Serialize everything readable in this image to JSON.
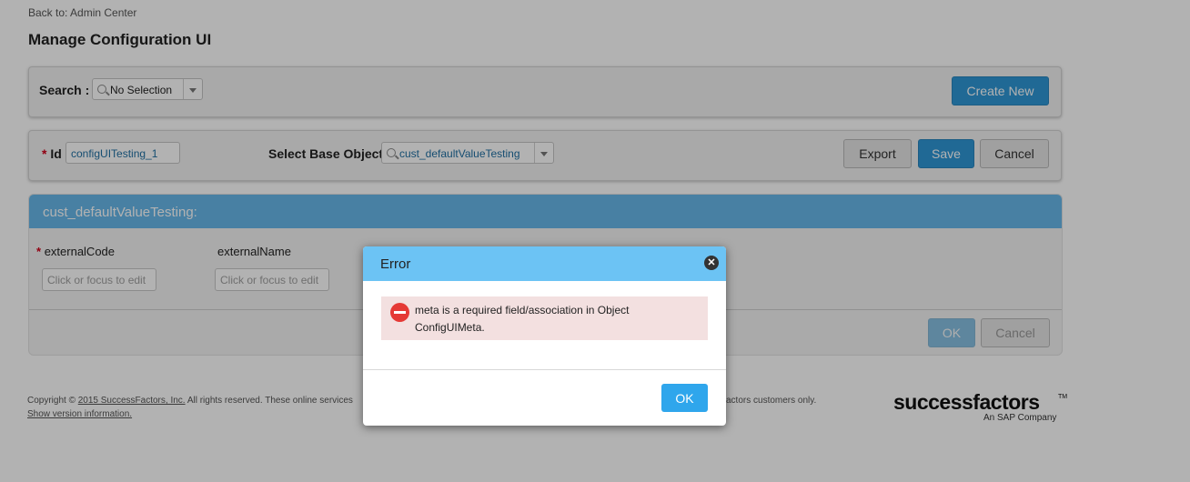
{
  "header": {
    "back_link": "Back to: Admin Center",
    "title": "Manage Configuration UI"
  },
  "search_bar": {
    "label": "Search :",
    "selected": "No Selection",
    "create_label": "Create New"
  },
  "config_form": {
    "required_mark": "*",
    "id_label": "Id",
    "id_value": "configUITesting_1",
    "base_object_label": "Select Base Object",
    "base_object_value": "cust_defaultValueTesting",
    "export_label": "Export",
    "save_label": "Save",
    "cancel_label": "Cancel"
  },
  "object_section": {
    "title": "cust_defaultValueTesting:",
    "fields": [
      {
        "label": "externalCode",
        "required": true,
        "placeholder": "Click or focus to edit"
      },
      {
        "label": "externalName",
        "required": false,
        "placeholder": "Click or focus to edit"
      }
    ],
    "ok_label": "OK",
    "cancel_label": "Cancel"
  },
  "footer": {
    "copyright_prefix": "Copyright ©",
    "copyright_link": "2015 SuccessFactors, Inc.",
    "copyright_rest": "All rights reserved. These online services",
    "copyright_tail": "actors customers only.",
    "version_link": "Show version information.",
    "logo_text": "successfactors",
    "logo_tm": "TM",
    "logo_sub": "An SAP Company"
  },
  "error_dialog": {
    "title": "Error",
    "message": "meta is a required field/association in Object ConfigUIMeta.",
    "ok_label": "OK"
  },
  "colors": {
    "primary_button": "#2f97d6",
    "dialog_header": "#6cc3f4",
    "section_header": "#67b8ea",
    "error_bg": "#f3e0e0",
    "error_icon": "#e53935"
  }
}
